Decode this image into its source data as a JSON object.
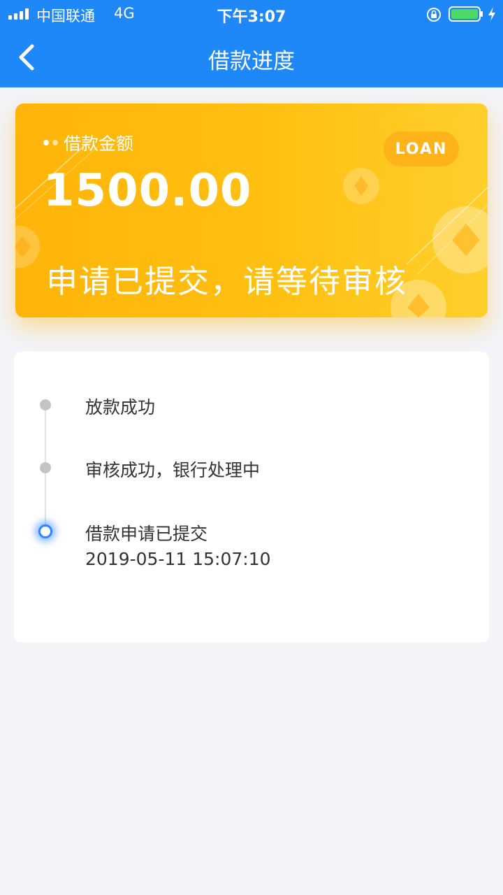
{
  "status_bar": {
    "carrier": "中国联通",
    "network": "4G",
    "time": "下午3:07"
  },
  "nav": {
    "title": "借款进度"
  },
  "card": {
    "amount_label": "借款金额",
    "amount": "1500.00",
    "badge": "LOAN",
    "status_message": "申请已提交，请等待审核"
  },
  "progress": {
    "steps": [
      {
        "label": "放款成功",
        "active": false
      },
      {
        "label": "审核成功，银行处理中",
        "active": false
      },
      {
        "label": "借款申请已提交",
        "time": "2019-05-11 15:07:10",
        "active": true
      }
    ]
  },
  "colors": {
    "header_blue": "#1e88f8",
    "card_orange": "#ffb409",
    "card_yellow": "#ffcf2c",
    "active_dot": "#2f86ff",
    "inactive_dot": "#c4c4c4",
    "background": "#f3f3f8"
  }
}
